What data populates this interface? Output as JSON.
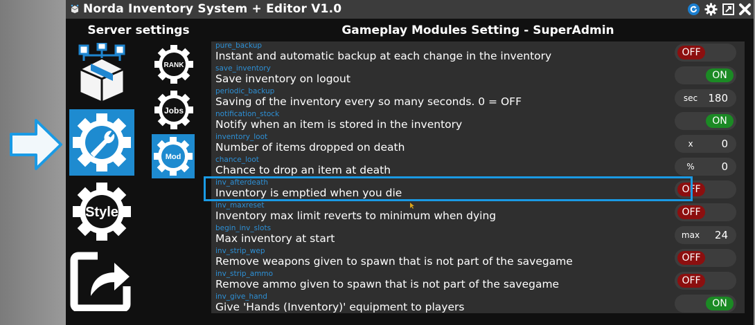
{
  "window": {
    "title": "Norda Inventory System + Editor V1.0"
  },
  "sidebar": {
    "title": "Server settings",
    "items": [
      {
        "name": "backup-box",
        "icon": "network-box-icon",
        "selected": false
      },
      {
        "name": "settings",
        "icon": "wrench-gear-icon",
        "selected": true
      },
      {
        "name": "style",
        "icon": "style-gear-icon",
        "label": "Style",
        "selected": false
      },
      {
        "name": "export",
        "icon": "share-arrow-icon",
        "selected": false
      }
    ],
    "subitems": [
      {
        "name": "rank",
        "label": "RANK",
        "selected": false
      },
      {
        "name": "jobs",
        "label": "Jobs",
        "selected": false
      },
      {
        "name": "mod",
        "label": "Mod",
        "selected": true
      }
    ]
  },
  "main": {
    "title": "Gameplay Modules Setting - SuperAdmin",
    "settings": [
      {
        "key": "pure_backup",
        "label": "Instant and automatic backup at each change in the inventory",
        "type": "toggle",
        "state": "OFF"
      },
      {
        "key": "save_inventory",
        "label": "Save inventory on logout",
        "type": "toggle",
        "state": "ON"
      },
      {
        "key": "periodic_backup",
        "label": "Saving of the inventory every so many seconds. 0 = OFF",
        "type": "number",
        "unit": "sec",
        "value": "180"
      },
      {
        "key": "notification_stock",
        "label": "Notify when an item is stored in the inventory",
        "type": "toggle",
        "state": "ON"
      },
      {
        "key": "inventory_loot",
        "label": "Number of items dropped on death",
        "type": "number",
        "unit": "x",
        "value": "0"
      },
      {
        "key": "chance_loot",
        "label": "Chance to drop an item at death",
        "type": "number",
        "unit": "%",
        "value": "0"
      },
      {
        "key": "inv_afterdeath",
        "label": "Inventory is emptied when you die",
        "type": "toggle",
        "state": "OFF",
        "highlighted": true
      },
      {
        "key": "inv_maxreset",
        "label": "Inventory max limit reverts to minimum when dying",
        "type": "toggle",
        "state": "OFF"
      },
      {
        "key": "begin_inv_slots",
        "label": "Max inventory at start",
        "type": "number",
        "unit": "max",
        "value": "24"
      },
      {
        "key": "inv_strip_wep",
        "label": "Remove weapons given to spawn that is not part of the savegame",
        "type": "toggle",
        "state": "OFF"
      },
      {
        "key": "inv_strip_ammo",
        "label": "Remove ammo given to spawn that is not part of the savegame",
        "type": "toggle",
        "state": "OFF"
      },
      {
        "key": "inv_give_hand",
        "label": "Give 'Hands (Inventory)' equipment to players",
        "type": "toggle",
        "state": "ON"
      }
    ]
  },
  "colors": {
    "accent": "#1a9ae4",
    "on": "#1b8a24",
    "off": "#8c0f0f",
    "key_text": "#2d90d6"
  },
  "titlebar_icons": [
    "refresh-icon",
    "gear-icon",
    "maximize-icon",
    "close-icon"
  ]
}
